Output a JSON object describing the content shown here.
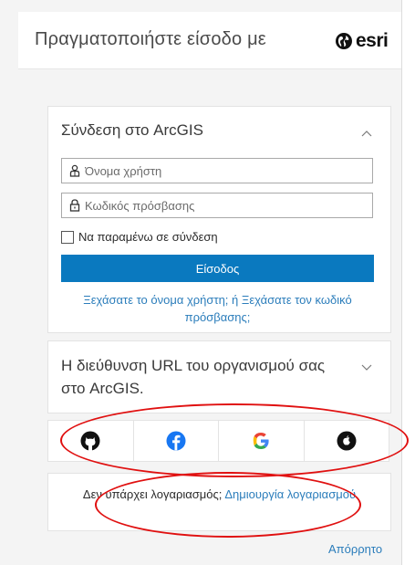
{
  "header": {
    "title": "Πραγματοποιήστε είσοδο με",
    "logo_text": "esri"
  },
  "signin": {
    "title": "Σύνδεση στο ArcGIS",
    "username_placeholder": "Όνομα χρήστη",
    "password_placeholder": "Κωδικός πρόσβασης",
    "remember_label": "Να παραμένω σε σύνδεση",
    "submit_label": "Είσοδος",
    "forgot_username": "Ξεχάσατε το όνομα χρήστη;",
    "forgot_separator": "ή",
    "forgot_password": "Ξεχάσατε τον κωδικό πρόσβασης;"
  },
  "org": {
    "title": "Η διεύθυνση URL του οργανισμού σας στο ArcGIS."
  },
  "social": {
    "providers": [
      "github",
      "facebook",
      "google",
      "apple"
    ]
  },
  "no_account": {
    "text": "Δεν υπάρχει λογαριασμός;",
    "create_link": "Δημιουργία λογαριασμού"
  },
  "footer": {
    "privacy_link": "Απόρρητο"
  },
  "colors": {
    "primary": "#0a79bf",
    "link": "#2b7dbb",
    "annotation": "#e01010",
    "facebook": "#1877f2"
  }
}
